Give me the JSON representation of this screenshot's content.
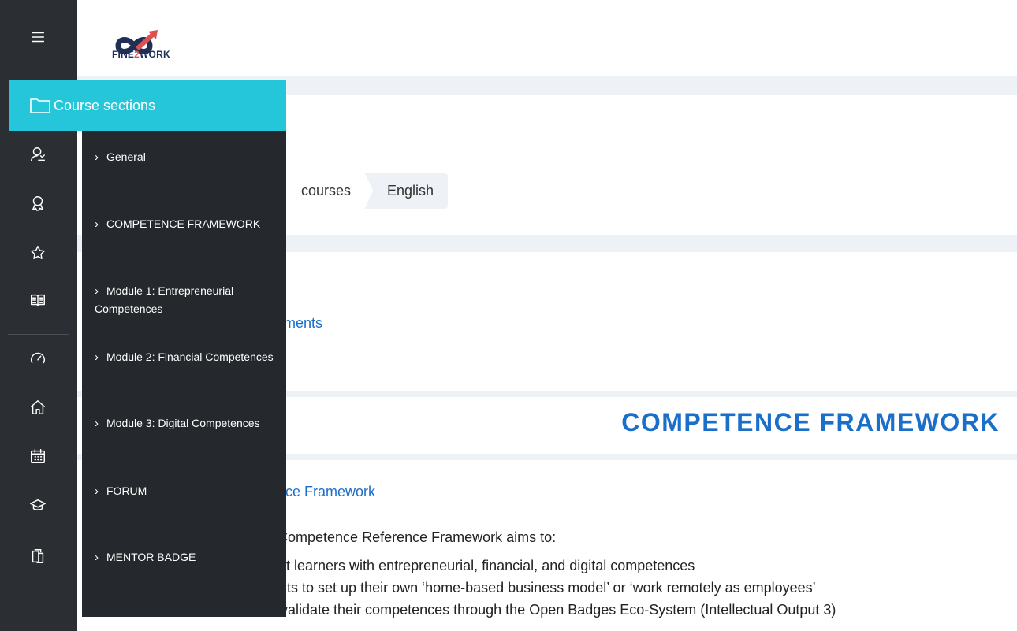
{
  "brand": {
    "name_part1": "FINE",
    "name_part2": "2",
    "name_part3": "WORK"
  },
  "colors": {
    "rail": "#2b2e33",
    "drawer": "#25282c",
    "drawer_header": "#26c6da",
    "link": "#1a6fc9"
  },
  "rail": {
    "icons": [
      "menu-icon",
      "participants-icon",
      "badges-icon",
      "competencies-icon",
      "grades-icon",
      "dashboard-icon",
      "home-icon",
      "calendar-icon",
      "courses-icon",
      "content-bank-icon"
    ]
  },
  "drawer": {
    "title": "Course sections",
    "sections": [
      {
        "label": "General"
      },
      {
        "label": "COMPETENCE FRAMEWORK"
      },
      {
        "label": "Module 1: Entrepreneurial Competences"
      },
      {
        "label": "Module 2: Financial Competences"
      },
      {
        "label": "Module 3: Digital Competences"
      },
      {
        "label": "FORUM"
      },
      {
        "label": "MENTOR BADGE"
      }
    ]
  },
  "breadcrumb": {
    "items": [
      "courses",
      "English"
    ]
  },
  "main": {
    "announcements_link": "ements",
    "section_title": "COMPETENCE FRAMEWORK",
    "framework_link": "nce Framework",
    "intro": "RK Competence Reference Framework aims to:",
    "lines": [
      "dult learners with entrepreneurial, financial, and digital competences",
      "ults to set up their own ‘home-based business model’ or ‘work remotely as employees’",
      "validate their competences through the Open Badges Eco-System (Intellectual Output 3)"
    ]
  }
}
